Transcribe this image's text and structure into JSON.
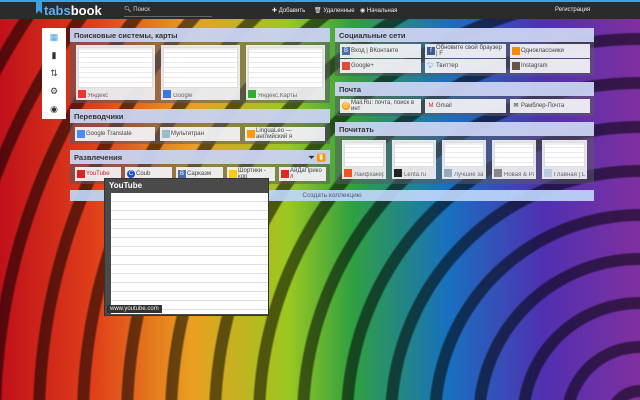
{
  "topbar": {
    "logo_a": "tabs",
    "logo_b": "book",
    "search_placeholder": "Поиск",
    "add": "Добавить",
    "deleted": "Удаленные",
    "home": "Начальная",
    "register": "Регистрация"
  },
  "sidebar": [
    "grid-icon",
    "bookmark-icon",
    "sort-icon",
    "gear-icon",
    "eye-icon"
  ],
  "left": [
    {
      "title": "Поисковые системы, карты",
      "thumbs": [
        "Яндекс",
        "Google",
        "Яндекс.Карты"
      ]
    },
    {
      "title": "Переводчики",
      "tiles": [
        "Google Translate",
        "Мультитран",
        "LinguaLeo — английский я"
      ]
    },
    {
      "title": "Развлечения",
      "tiles": [
        "YouTube",
        "Coub",
        "Сарказм",
        "Шортики - кор",
        "АйДаПрикол"
      ]
    }
  ],
  "right": [
    {
      "title": "Социальные сети",
      "tiles": [
        "Вход | ВКонтакте",
        "Обновите свой браузер | F",
        "Одноклассники",
        "Google+",
        "Твиттер",
        "Instagram"
      ]
    },
    {
      "title": "Почта",
      "tiles": [
        "Mail.Ru: почта, поиск в инт",
        "Gmail",
        "Рамблер-Почта"
      ]
    },
    {
      "title": "Почитать",
      "thumbs": [
        "Лайфхакер",
        "Lenta.ru",
        "Лучшие за сут",
        "Новая & Разв",
        "Главная | Цук"
      ]
    }
  ],
  "create": "Создать коллекцию",
  "preview": {
    "title": "YouTube",
    "url": "www.youtube.com"
  },
  "colors": {
    "accent": "#3ea0e0",
    "topbar": "#2b2b2b"
  }
}
